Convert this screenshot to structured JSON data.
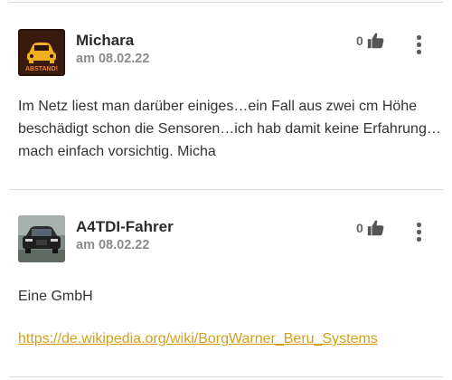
{
  "posts": [
    {
      "username": "Michara",
      "date": "am 08.02.22",
      "likes": "0",
      "avatar_icon": "car-warning-avatar",
      "avatar_text": "ABSTAND!",
      "body": "Im Netz liest man darüber einiges…ein Fall aus zwei cm Höhe beschädigt schon die Sensoren…ich hab damit keine Erfahrung…mach einfach vorsichtig. Micha"
    },
    {
      "username": "A4TDI-Fahrer",
      "date": "am 08.02.22",
      "likes": "0",
      "avatar_icon": "car-photo-avatar",
      "body": "Eine GmbH",
      "link": "https://de.wikipedia.org/wiki/BorgWarner_Beru_Systems"
    }
  ],
  "colors": {
    "link": "#d4a017",
    "divider": "#dcdcdc",
    "date": "#8c8c8c"
  }
}
